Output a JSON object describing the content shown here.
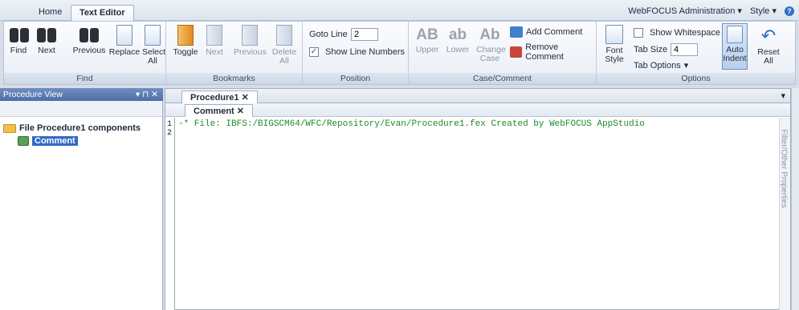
{
  "menu_tabs": [
    "Home",
    "Text Editor"
  ],
  "admin": {
    "label": "WebFOCUS Administration",
    "style": "Style"
  },
  "ribbon": {
    "find": {
      "group": "Find",
      "buttons": [
        "Find",
        "Next",
        "Previous",
        "Replace",
        "Select All"
      ]
    },
    "bookmarks": {
      "group": "Bookmarks",
      "buttons": [
        "Toggle",
        "Next",
        "Previous",
        "Delete All"
      ]
    },
    "position": {
      "group": "Position",
      "goto_label": "Goto Line",
      "goto_value": "2",
      "show_line_numbers": "Show Line Numbers"
    },
    "case_comment": {
      "group": "Case/Comment",
      "upper": "Upper",
      "lower": "Lower",
      "change_case": "Change Case",
      "add_comment": "Add Comment",
      "remove_comment": "Remove Comment"
    },
    "options": {
      "group": "Options",
      "font_style": "Font Style",
      "show_whitespace": "Show Whitespace",
      "tab_size_label": "Tab Size",
      "tab_size_value": "4",
      "tab_options": "Tab Options",
      "auto_indent": "Auto Indent",
      "reset_all": "Reset All"
    }
  },
  "procedure_view": {
    "title": "Procedure View",
    "root": "File Procedure1 components",
    "child": "Comment"
  },
  "editor": {
    "doc_tab": "Procedure1",
    "sub_tab": "Comment",
    "lines": [
      "1",
      "2"
    ],
    "code_line1": "-* File: IBFS:/BIGSCM64/WFC/Repository/Evan/Procedure1.fex Created by WebFOCUS AppStudio"
  },
  "right_panel_label": "Filter/Other Properties"
}
